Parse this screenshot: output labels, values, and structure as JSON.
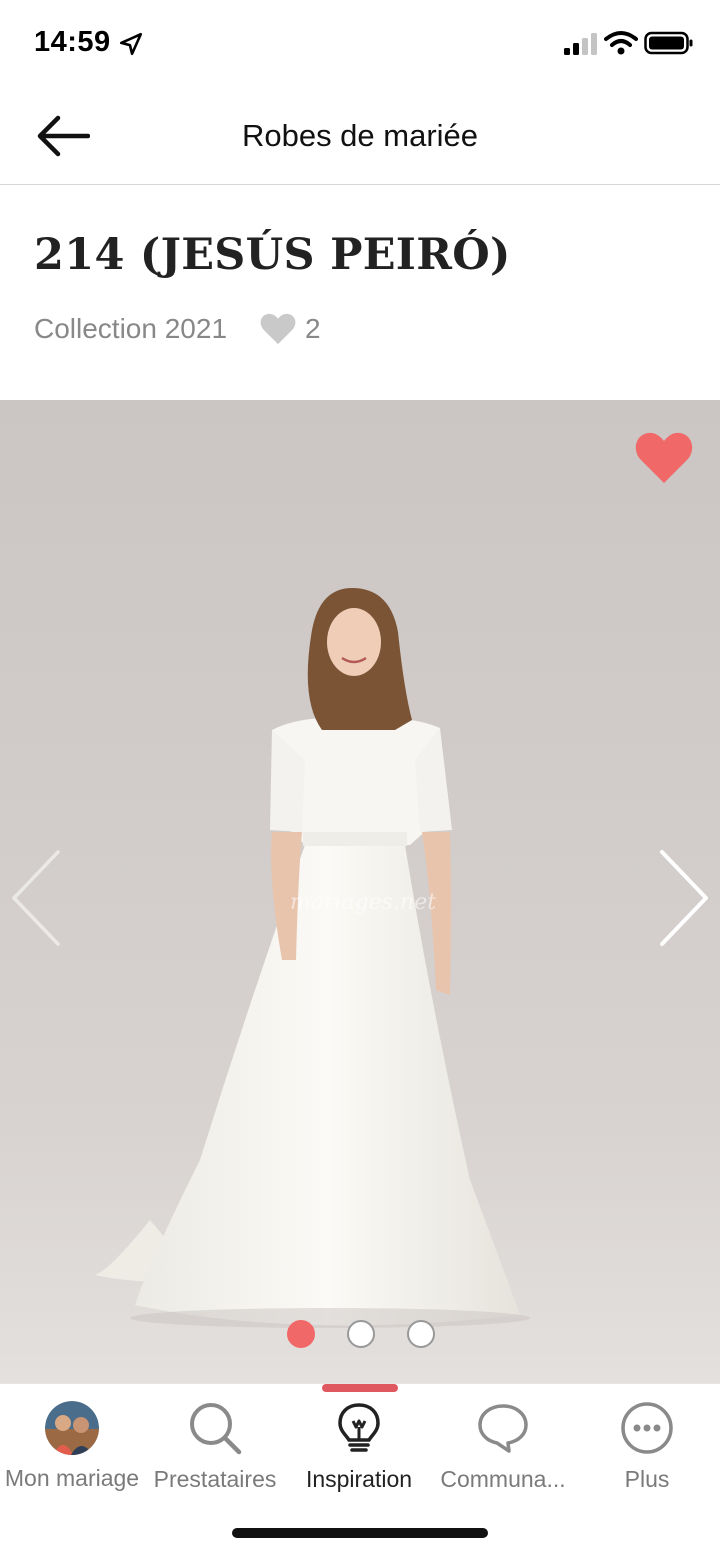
{
  "status_bar": {
    "time": "14:59"
  },
  "header": {
    "title": "Robes de mariée"
  },
  "product": {
    "name": "214 (JESÚS PEIRÓ)",
    "collection": "Collection 2021",
    "likes": "2"
  },
  "gallery": {
    "image_count": 3,
    "current_index": 0,
    "watermark": "mariages.net"
  },
  "tabs": [
    {
      "label": "Mon mariage",
      "icon": "avatar"
    },
    {
      "label": "Prestataires",
      "icon": "search-icon"
    },
    {
      "label": "Inspiration",
      "icon": "lightbulb-icon",
      "active": true
    },
    {
      "label": "Communa...",
      "icon": "chat-bubble-icon"
    },
    {
      "label": "Plus",
      "icon": "more-icon"
    }
  ],
  "colors": {
    "accent": "#f06868",
    "tab_indicator": "#e0585f",
    "muted_text": "#888888"
  }
}
